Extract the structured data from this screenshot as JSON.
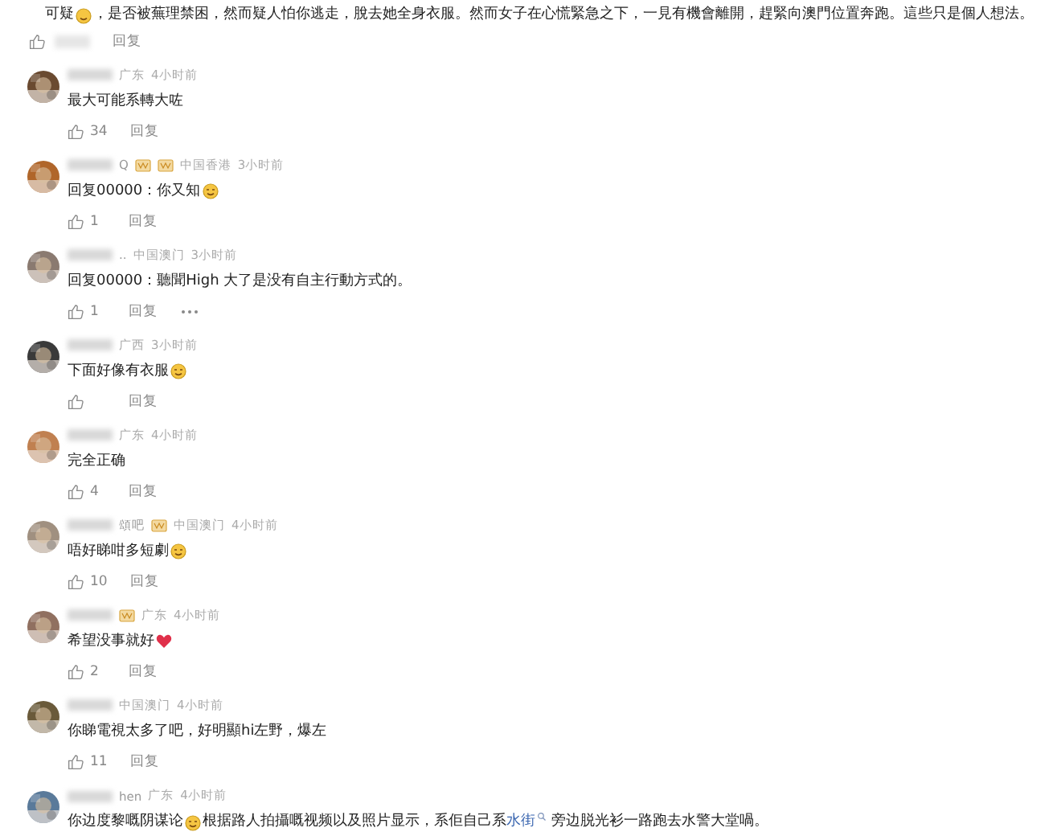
{
  "top_comment": {
    "segments": [
      {
        "kind": "text",
        "text": "可疑"
      },
      {
        "kind": "emoji"
      },
      {
        "kind": "text",
        "text": "，是否被蕪理禁困，然而疑人怕你逃走，脫去她全身衣服。然而女子在心慌緊急之下，一見有機會離開，趕緊向澳門位置奔跑。這些只是個人想法。"
      }
    ],
    "reply": "回复"
  },
  "comments": [
    {
      "location": "广东",
      "time": "4小时前",
      "segments": [
        {
          "kind": "text",
          "text": "最大可能系轉大咗"
        }
      ],
      "likes": "34",
      "reply": "回复",
      "more": false
    },
    {
      "name": "Q",
      "badges": [
        {
          "kind": "vip"
        },
        {
          "kind": "vip"
        }
      ],
      "location": "中国香港",
      "time": "3小时前",
      "segments": [
        {
          "kind": "text",
          "text": "回复00000：你又知"
        },
        {
          "kind": "emoji"
        }
      ],
      "likes": "1",
      "reply": "回复",
      "more": false
    },
    {
      "name": "..",
      "location": "中国澳门",
      "time": "3小时前",
      "segments": [
        {
          "kind": "text",
          "text": "回复00000：聽聞High 大了是没有自主行動方式的。"
        }
      ],
      "likes": "1",
      "reply": "回复",
      "more": true
    },
    {
      "location": "广西",
      "time": "3小时前",
      "segments": [
        {
          "kind": "text",
          "text": "下面好像有衣服"
        },
        {
          "kind": "emoji"
        }
      ],
      "reply": "回复",
      "more": false
    },
    {
      "location": "广东",
      "time": "4小时前",
      "segments": [
        {
          "kind": "text",
          "text": "完全正确"
        }
      ],
      "likes": "4",
      "reply": "回复",
      "more": false
    },
    {
      "name": "頌吧",
      "badges": [
        {
          "kind": "vip"
        }
      ],
      "location": "中国澳门",
      "time": "4小时前",
      "segments": [
        {
          "kind": "text",
          "text": "唔好睇咁多短劇"
        },
        {
          "kind": "emoji"
        }
      ],
      "likes": "10",
      "reply": "回复",
      "more": false
    },
    {
      "badges": [
        {
          "kind": "vip"
        }
      ],
      "location": "广东",
      "time": "4小时前",
      "segments": [
        {
          "kind": "text",
          "text": "希望没事就好"
        },
        {
          "kind": "heart"
        }
      ],
      "likes": "2",
      "reply": "回复",
      "more": false
    },
    {
      "location": "中国澳门",
      "time": "4小时前",
      "segments": [
        {
          "kind": "text",
          "text": "你睇電視太多了吧，好明顯hi左野，爆左"
        }
      ],
      "likes": "11",
      "reply": "回复",
      "more": false
    },
    {
      "name": "hen",
      "location": "广东",
      "time": "4小时前",
      "segments": [
        {
          "kind": "text",
          "text": "你边度黎嘅阴谋论"
        },
        {
          "kind": "emoji"
        },
        {
          "kind": "text",
          "text": "根据路人拍攝嘅视频以及照片显示，系佢自己系"
        },
        {
          "kind": "link",
          "text": "水街"
        },
        {
          "kind": "text",
          "text": " 旁边脱光衫一路跑去水警大堂喎。"
        }
      ]
    }
  ]
}
